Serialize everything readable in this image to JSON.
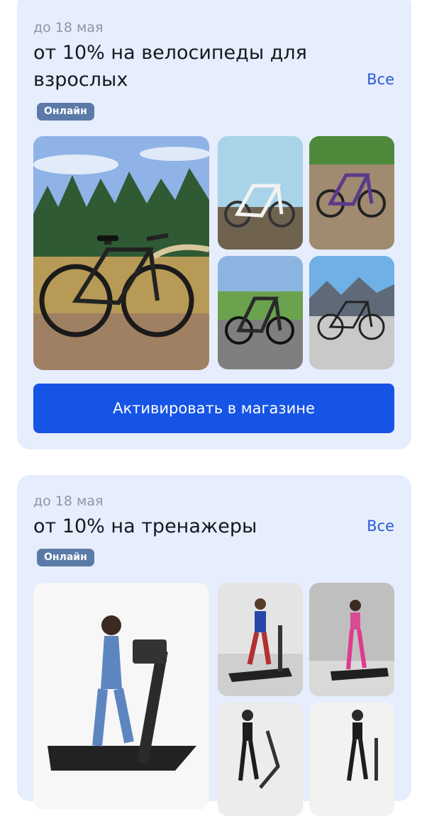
{
  "offers": [
    {
      "date": "до 18 мая",
      "title": "от 10% на велосипеды для взрослых",
      "all_label": "Все",
      "badge": "Онлайн",
      "button_label": "Активировать в магазине",
      "images": [
        "bicycle-main-image",
        "bicycle-white-image",
        "bicycle-purple-image",
        "bicycle-dark-image",
        "bicycle-mountain-image"
      ]
    },
    {
      "date": "до 18 мая",
      "title": "от 10% на тренажеры",
      "all_label": "Все",
      "badge": "Онлайн",
      "images": [
        "treadmill-main-image",
        "treadmill-man-image",
        "walking-pad-image",
        "elliptical-image",
        "treadmill-woman-image"
      ]
    }
  ]
}
